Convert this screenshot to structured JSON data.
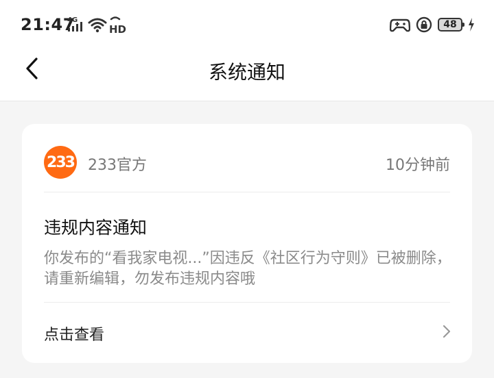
{
  "status_bar": {
    "time": "21:47",
    "network": "4G",
    "battery_level": "48"
  },
  "header": {
    "title": "系统通知"
  },
  "notification": {
    "sender_avatar_text": "233",
    "sender_name": "233官方",
    "timestamp": "10分钟前",
    "title": "违规内容通知",
    "body": "你发布的“看我家电视...”因违反《社区行为守则》已被删除，请重新编辑，勿发布违规内容哦",
    "action_label": "点击查看"
  },
  "colors": {
    "brand_orange": "#ff6a13",
    "background": "#f5f5f5"
  },
  "icons": {
    "back": "chevron-left-icon",
    "action": "chevron-right-icon",
    "signal": "signal-icon",
    "wifi": "wifi-icon",
    "game": "gamepad-icon",
    "lock": "rotation-lock-icon",
    "battery": "battery-icon",
    "charging": "charging-icon"
  }
}
